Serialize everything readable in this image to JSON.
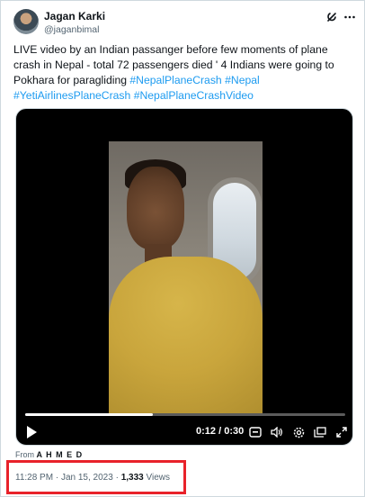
{
  "author": {
    "name": "Jagan Karki",
    "handle": "@jaganbimal"
  },
  "tweet": {
    "text_lines": [
      "LIVE video by an Indian passanger before few moments of plane crash in Nepal - total 72 passengers died ' 4 Indians were going to Pokhara for paragliding "
    ],
    "hashtags": [
      "#NepalPlaneCrash",
      "#Nepal",
      "#YetiAirlinesPlaneCrash",
      "#NepalPlaneCrashVideo"
    ]
  },
  "video": {
    "time_current": "0:12",
    "time_separator": "/",
    "time_total": "0:30",
    "progress_fraction": 0.4
  },
  "attribution": {
    "prefix": "From",
    "source": "A H M E D"
  },
  "meta": {
    "time": "11:28 PM",
    "separator1": "·",
    "date": "Jan 15, 2023",
    "separator2": "·",
    "views_count": "1,333",
    "views_label": "Views"
  },
  "colors": {
    "highlight": "#e8222a",
    "link": "#1d9bf0"
  },
  "icons": [
    "grok-icon",
    "more-icon",
    "play-icon",
    "captions-icon",
    "volume-icon",
    "settings-icon",
    "pip-icon",
    "fullscreen-icon"
  ]
}
